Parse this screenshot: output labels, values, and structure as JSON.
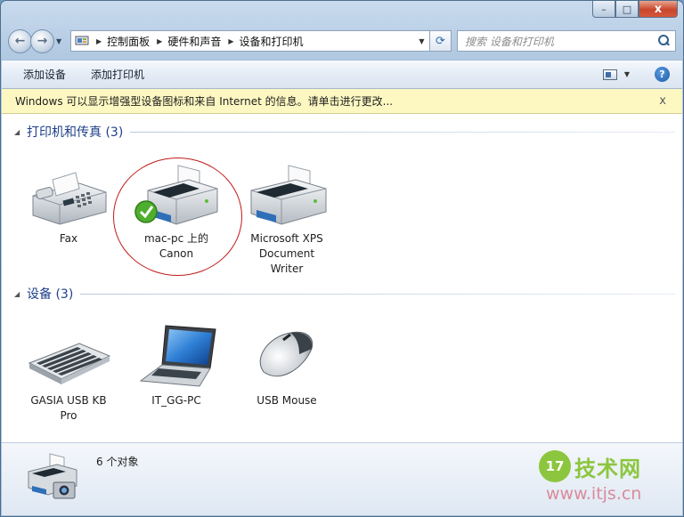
{
  "window": {
    "caption": {
      "minimize": "–",
      "maximize": "□",
      "close": "x"
    }
  },
  "nav": {
    "back_glyph": "←",
    "forward_glyph": "→",
    "breadcrumb": [
      "控制面板",
      "硬件和声音",
      "设备和打印机"
    ],
    "refresh_glyph": "⟳",
    "search_placeholder": "搜索 设备和打印机"
  },
  "commandbar": {
    "add_device": "添加设备",
    "add_printer": "添加打印机",
    "help": "?"
  },
  "infobar": {
    "text": "Windows 可以显示增强型设备图标和来自 Internet 的信息。请单击进行更改...",
    "close": "x"
  },
  "groups": {
    "printers": {
      "title": "打印机和传真 (3)",
      "items": [
        {
          "label": "Fax",
          "icon": "fax-icon"
        },
        {
          "label": "mac-pc 上的\nCanon",
          "icon": "printer-default-icon",
          "default": true
        },
        {
          "label": "Microsoft XPS\nDocument\nWriter",
          "icon": "printer-icon"
        }
      ]
    },
    "devices": {
      "title": "设备 (3)",
      "items": [
        {
          "label": "GASIA USB KB\nPro",
          "icon": "keyboard-icon"
        },
        {
          "label": "IT_GG-PC",
          "icon": "laptop-icon"
        },
        {
          "label": "USB Mouse",
          "icon": "mouse-icon"
        }
      ]
    }
  },
  "details": {
    "text": "6 个对象",
    "icon": "devices-printers-icon"
  },
  "watermark": {
    "badge": "17",
    "name": "技术网",
    "url": "www.itjs.cn"
  },
  "colors": {
    "group_title": "#1e3f8a",
    "infobar_bg": "#fdf8c2",
    "highlight_circle": "#c11a1a",
    "close_button": "#c9472c"
  }
}
